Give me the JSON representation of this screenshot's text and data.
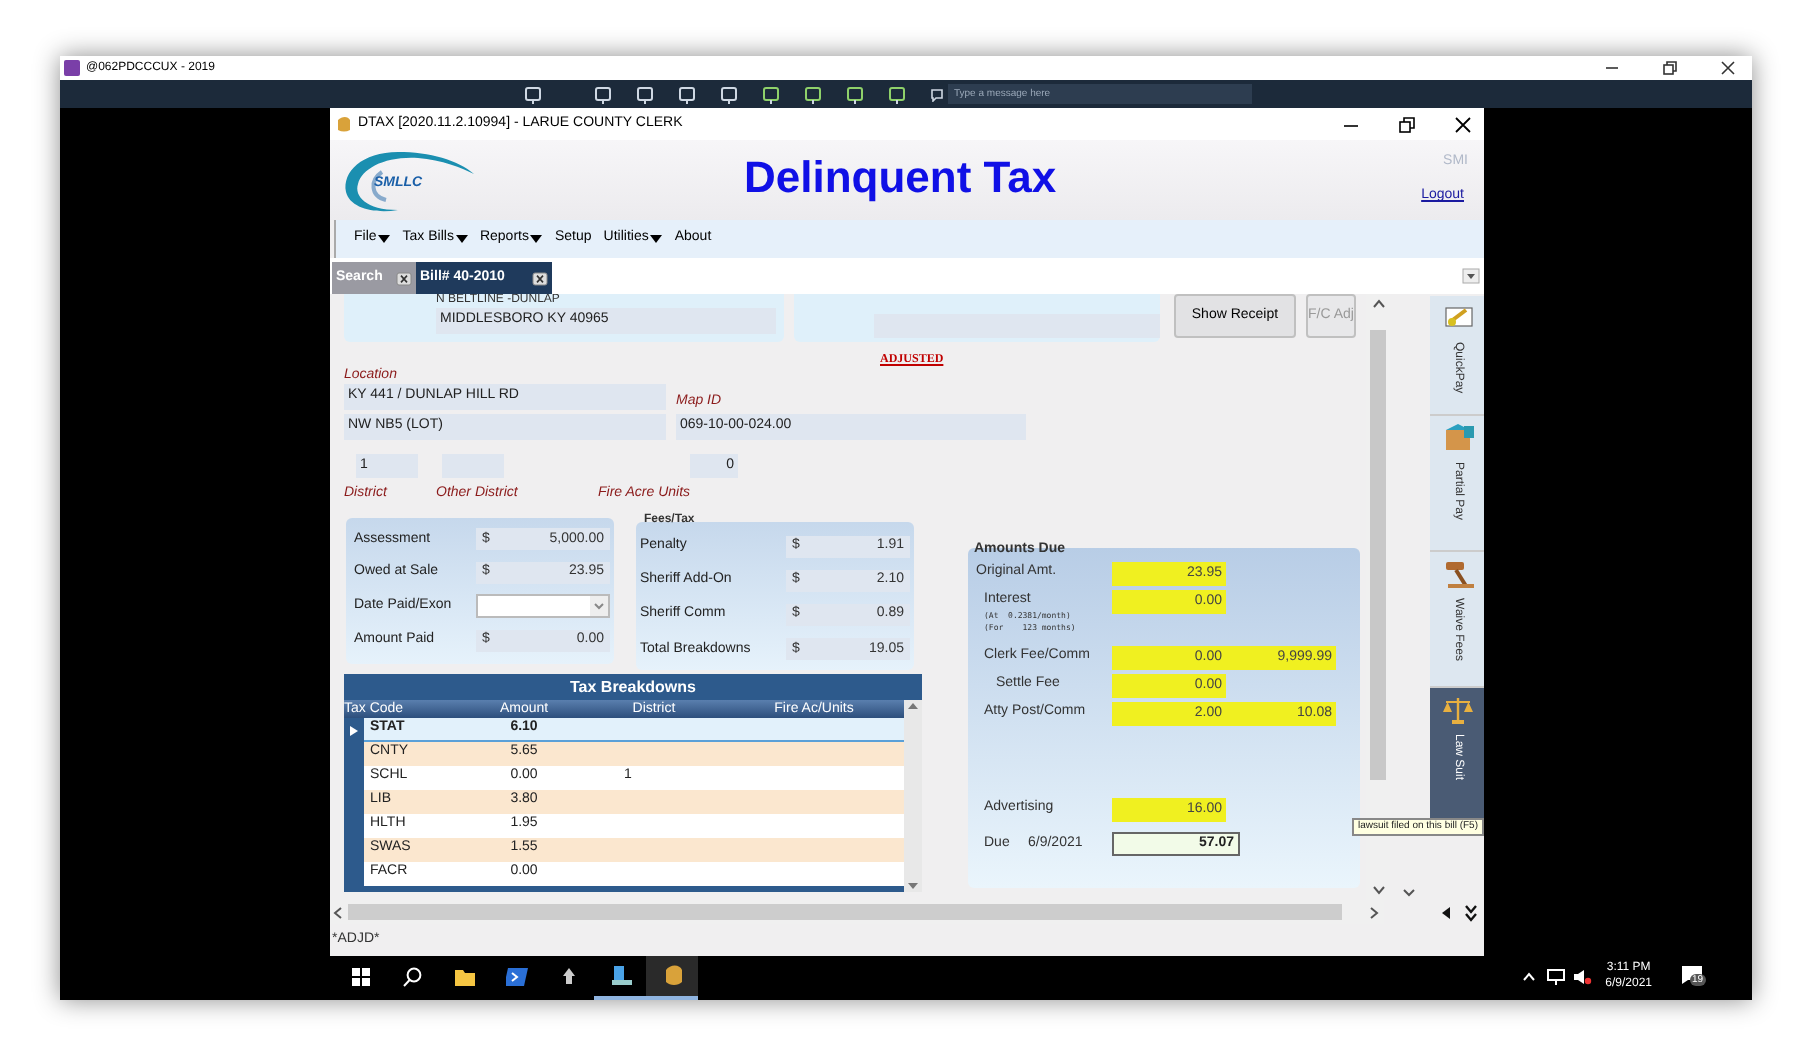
{
  "remote_window": {
    "title": "@062PDCCCUX - 2019",
    "message_placeholder": "Type a message here"
  },
  "app": {
    "title": "DTAX [2020.11.2.10994] - LARUE COUNTY CLERK",
    "heading": "Delinquent Tax",
    "logo_text": "SMLLC",
    "user": "SMI",
    "logout": "Logout"
  },
  "menu": [
    {
      "label": "File",
      "dropdown": true
    },
    {
      "label": "Tax Bills",
      "dropdown": true
    },
    {
      "label": "Reports",
      "dropdown": true
    },
    {
      "label": "Setup",
      "dropdown": false
    },
    {
      "label": "Utilities",
      "dropdown": true
    },
    {
      "label": "About",
      "dropdown": false
    }
  ],
  "tabs": [
    {
      "label": "Search",
      "selected": false
    },
    {
      "label": "Bill# 40-2010",
      "selected": true
    }
  ],
  "owner": {
    "address_line": "N BELTLINE -DUNLAP",
    "city_line": "MIDDLESBORO KY 40965"
  },
  "buttons": [
    {
      "label": "Show Receipt",
      "disabled": false
    },
    {
      "label": "F/C Adj",
      "disabled": true
    }
  ],
  "status_stamp": "ADJUSTED",
  "location": {
    "label": "Location",
    "line_1": "KY 441 / DUNLAP HILL RD",
    "line_2": "NW NB5 (LOT)"
  },
  "map_id": {
    "label": "Map ID",
    "value": "069-10-00-024.00"
  },
  "district_fields": [
    {
      "label": "District",
      "value": "1"
    },
    {
      "label": "Other District"
    },
    {
      "label": "Fire Acre Units",
      "value": "0"
    }
  ],
  "bill_fields": [
    {
      "label": "Assessment",
      "kind": "money",
      "currency": "$",
      "value": "5,000.00"
    },
    {
      "label": "Owed at Sale",
      "kind": "money",
      "currency": "$",
      "value": "23.95"
    },
    {
      "label": "Date Paid/Exon",
      "kind": "date"
    },
    {
      "label": "Amount Paid",
      "kind": "money",
      "currency": "$",
      "value": "0.00"
    }
  ],
  "fees": {
    "title": "Fees/Tax",
    "rows": [
      {
        "label": "Penalty",
        "currency": "$",
        "value": "1.91"
      },
      {
        "label": "Sheriff Add-On",
        "currency": "$",
        "value": "2.10"
      },
      {
        "label": "Sheriff Comm",
        "currency": "$",
        "value": "0.89"
      },
      {
        "label": "Total Breakdowns",
        "currency": "$",
        "value": "19.05"
      }
    ]
  },
  "tax_breakdowns": {
    "title": "Tax Breakdowns",
    "columns": [
      "Tax Code",
      "Amount",
      "District",
      "Fire Ac/Units"
    ],
    "rows": [
      {
        "code": "STAT",
        "amount": "6.10",
        "selected": true
      },
      {
        "code": "CNTY",
        "amount": "5.65",
        "selected": false
      },
      {
        "code": "SCHL",
        "amount": "0.00",
        "district": "1",
        "selected": false
      },
      {
        "code": "LIB",
        "amount": "3.80",
        "selected": false
      },
      {
        "code": "HLTH",
        "amount": "1.95",
        "selected": false
      },
      {
        "code": "SWAS",
        "amount": "1.55",
        "selected": false
      },
      {
        "code": "FACR",
        "amount": "0.00",
        "selected": false
      }
    ]
  },
  "amounts_due": {
    "title": "Amounts Due",
    "rows": [
      {
        "label": "Original Amt.",
        "value": "23.95",
        "highlighted": true
      },
      {
        "label": "Interest",
        "notes": [
          "(At  0.2381/month)",
          "(For    123 months)"
        ],
        "value": "0.00",
        "highlighted": true
      },
      {
        "label": "Clerk Fee/Comm",
        "value": "0.00",
        "value_2": "9,999.99",
        "highlighted": true
      },
      {
        "label": "Settle Fee",
        "value": "0.00",
        "highlighted": true
      },
      {
        "label": "Atty Post/Comm",
        "value": "2.00",
        "value_2": "10.08",
        "highlighted": true
      },
      {
        "label": "Advertising",
        "value": "16.00",
        "highlighted": true
      }
    ],
    "due_label": "Due",
    "due_date": "6/9/2021",
    "due_total": "57.07"
  },
  "side_tabs": [
    {
      "label": "QuickPay",
      "selected": false
    },
    {
      "label": "Partial Pay",
      "selected": false
    },
    {
      "label": "Waive Fees",
      "selected": false
    },
    {
      "label": "Law Suit",
      "selected": true
    }
  ],
  "tooltip": "lawsuit filed on this bill (F5)",
  "status_bar": "*ADJD*",
  "taskbar": {
    "time": "3:11 PM",
    "date": "6/9/2021",
    "notification_count": "19"
  }
}
